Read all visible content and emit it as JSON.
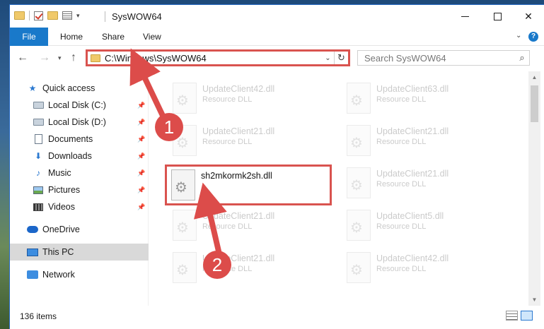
{
  "window": {
    "title": "SysWOW64",
    "ribbon_tabs": [
      "File",
      "Home",
      "Share",
      "View"
    ]
  },
  "address_bar": {
    "path": "C:\\Windows\\SysWOW64",
    "search_placeholder": "Search SysWOW64"
  },
  "sidebar": {
    "items": [
      {
        "label": "Quick access",
        "icon": "star-icon"
      },
      {
        "label": "Local Disk (C:)",
        "icon": "disk-icon",
        "pinned": true
      },
      {
        "label": "Local Disk (D:)",
        "icon": "disk-icon",
        "pinned": true
      },
      {
        "label": "Documents",
        "icon": "document-icon",
        "pinned": true
      },
      {
        "label": "Downloads",
        "icon": "download-icon",
        "pinned": true
      },
      {
        "label": "Music",
        "icon": "music-icon",
        "pinned": true
      },
      {
        "label": "Pictures",
        "icon": "pictures-icon",
        "pinned": true
      },
      {
        "label": "Videos",
        "icon": "videos-icon",
        "pinned": true
      },
      {
        "label": "OneDrive",
        "icon": "cloud-icon"
      },
      {
        "label": "This PC",
        "icon": "computer-icon",
        "selected": true
      },
      {
        "label": "Network",
        "icon": "network-icon"
      }
    ]
  },
  "files": {
    "left": [
      {
        "name": "UpdateClient42.dll",
        "type": "Resource DLL"
      },
      {
        "name": "UpdateClient21.dll",
        "type": "Resource DLL"
      },
      {
        "name": "sh2mkormk2sh.dll",
        "type": ""
      },
      {
        "name": "UpdateClient21.dll",
        "type": "Resource DLL"
      },
      {
        "name": "UpdateClient21.dll",
        "type": "Resource DLL"
      }
    ],
    "right": [
      {
        "name": "UpdateClient63.dll",
        "type": "Resource DLL"
      },
      {
        "name": "UpdateClient21.dll",
        "type": "Resource DLL"
      },
      {
        "name": "UpdateClient21.dll",
        "type": "Resource DLL"
      },
      {
        "name": "UpdateClient5.dll",
        "type": "Resource DLL"
      },
      {
        "name": "UpdateClient42.dll",
        "type": "Resource DLL"
      }
    ]
  },
  "status": {
    "item_count": "136 items"
  },
  "annotations": {
    "step1": "1",
    "step2": "2",
    "color": "#dc4c4a"
  }
}
